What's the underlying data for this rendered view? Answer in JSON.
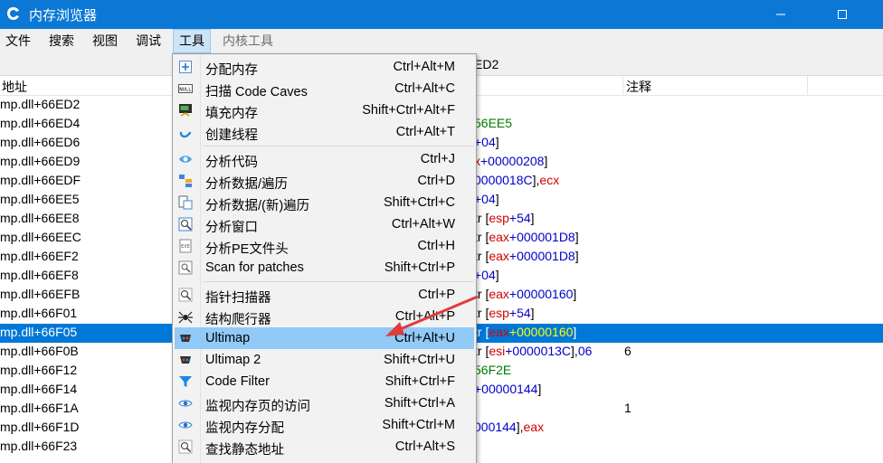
{
  "window": {
    "title": "内存浏览器"
  },
  "menubar": {
    "items": [
      "文件",
      "搜索",
      "视图",
      "调试",
      "工具",
      "内核工具"
    ]
  },
  "address_line": "ED2",
  "columns": {
    "address": "地址",
    "comment": "注释"
  },
  "rows": [
    {
      "addr": "mp.dll+66ED2",
      "op": []
    },
    {
      "addr": "mp.dll+66ED4",
      "op": [
        [
          "green",
          "56EE5"
        ]
      ]
    },
    {
      "addr": "mp.dll+66ED6",
      "op": [
        [
          "blue",
          "+04"
        ],
        [
          "",
          "]"
        ]
      ]
    },
    {
      "addr": "mp.dll+66ED9",
      "op": [
        [
          "red",
          "x"
        ],
        [
          "blue",
          "+00000208"
        ],
        [
          "",
          "]"
        ]
      ]
    },
    {
      "addr": "mp.dll+66EDF",
      "op": [
        [
          "blue",
          "0000018C"
        ],
        [
          "",
          "],"
        ],
        [
          "red",
          "ecx"
        ]
      ]
    },
    {
      "addr": "mp.dll+66EE5",
      "op": [
        [
          "blue",
          "+04"
        ],
        [
          "",
          "]"
        ]
      ]
    },
    {
      "addr": "mp.dll+66EE8",
      "op": [
        [
          "",
          "tr ["
        ],
        [
          "red",
          "esp"
        ],
        [
          "blue",
          "+54"
        ],
        [
          "",
          "]"
        ]
      ]
    },
    {
      "addr": "mp.dll+66EEC",
      "op": [
        [
          "",
          "tr ["
        ],
        [
          "red",
          "eax"
        ],
        [
          "blue",
          "+000001D8"
        ],
        [
          "",
          "]"
        ]
      ]
    },
    {
      "addr": "mp.dll+66EF2",
      "op": [
        [
          "",
          "tr ["
        ],
        [
          "red",
          "eax"
        ],
        [
          "blue",
          "+000001D8"
        ],
        [
          "",
          "]"
        ]
      ]
    },
    {
      "addr": "mp.dll+66EF8",
      "op": [
        [
          "blue",
          "+04"
        ],
        [
          "",
          "]"
        ]
      ]
    },
    {
      "addr": "mp.dll+66EFB",
      "op": [
        [
          "",
          "tr ["
        ],
        [
          "red",
          "eax"
        ],
        [
          "blue",
          "+00000160"
        ],
        [
          "",
          "]"
        ]
      ]
    },
    {
      "addr": "mp.dll+66F01",
      "op": [
        [
          "",
          "tr ["
        ],
        [
          "red",
          "esp"
        ],
        [
          "blue",
          "+54"
        ],
        [
          "",
          "]"
        ]
      ]
    },
    {
      "addr": "mp.dll+66F05",
      "op": [
        [
          "",
          "tr ["
        ],
        [
          "red",
          "eax"
        ],
        [
          "yl",
          "+00000160"
        ],
        [
          "",
          "]"
        ]
      ],
      "selected": true
    },
    {
      "addr": "mp.dll+66F0B",
      "op": [
        [
          "",
          "tr ["
        ],
        [
          "red",
          "esi"
        ],
        [
          "blue",
          "+0000013C"
        ],
        [
          "",
          "],"
        ],
        [
          "blue",
          "06"
        ]
      ],
      "cmt": "6"
    },
    {
      "addr": "mp.dll+66F12",
      "op": [
        [
          "green",
          "56F2E"
        ]
      ]
    },
    {
      "addr": "mp.dll+66F14",
      "op": [
        [
          "blue",
          "+00000144"
        ],
        [
          "",
          "]"
        ]
      ]
    },
    {
      "addr": "mp.dll+66F1A",
      "op": [],
      "cmt": "1"
    },
    {
      "addr": "mp.dll+66F1D",
      "op": [
        [
          "blue",
          "000144"
        ],
        [
          "",
          "],"
        ],
        [
          "red",
          "eax"
        ]
      ]
    },
    {
      "addr": "mp.dll+66F23",
      "op": []
    }
  ],
  "tools_menu": {
    "groups": [
      [
        {
          "icon": "plus-icon",
          "label": "分配内存",
          "shortcut": "Ctrl+Alt+M"
        },
        {
          "icon": "scan-icon",
          "label": "扫描 Code Caves",
          "shortcut": "Ctrl+Alt+C"
        },
        {
          "icon": "fill-icon",
          "label": "填充内存",
          "shortcut": "Shift+Ctrl+Alt+F"
        },
        {
          "icon": "thread-icon",
          "label": "创建线程",
          "shortcut": "Ctrl+Alt+T"
        }
      ],
      [
        {
          "icon": "eye-code-icon",
          "label": "分析代码",
          "shortcut": "Ctrl+J"
        },
        {
          "icon": "struct-icon",
          "label": "分析数据/遍历",
          "shortcut": "Ctrl+D"
        },
        {
          "icon": "struct-new-icon",
          "label": "分析数据/(新)遍历",
          "shortcut": "Shift+Ctrl+C"
        },
        {
          "icon": "window-icon",
          "label": "分析窗口",
          "shortcut": "Ctrl+Alt+W"
        },
        {
          "icon": "exe-icon",
          "label": "分析PE文件头",
          "shortcut": "Ctrl+H"
        },
        {
          "icon": "patch-icon",
          "label": "Scan for patches",
          "shortcut": "Shift+Ctrl+P"
        }
      ],
      [
        {
          "icon": "magnifier-icon",
          "label": "指针扫描器",
          "shortcut": "Ctrl+P"
        },
        {
          "icon": "spider-icon",
          "label": "结构爬行器",
          "shortcut": "Ctrl+Alt+P"
        },
        {
          "icon": "ultimap-icon",
          "label": "Ultimap",
          "shortcut": "Ctrl+Alt+U",
          "highlighted": true
        },
        {
          "icon": "ultimap2-icon",
          "label": "Ultimap 2",
          "shortcut": "Shift+Ctrl+U"
        },
        {
          "icon": "filter-icon",
          "label": "Code Filter",
          "shortcut": "Shift+Ctrl+F"
        },
        {
          "icon": "eye-icon",
          "label": "监视内存页的访问",
          "shortcut": "Shift+Ctrl+A"
        },
        {
          "icon": "eye-icon",
          "label": "监视内存分配",
          "shortcut": "Shift+Ctrl+M"
        },
        {
          "icon": "magnifier-icon",
          "label": "查找静态地址",
          "shortcut": "Ctrl+Alt+S"
        }
      ]
    ]
  },
  "colors": {
    "titlebar": "#0c78d6",
    "selection": "#0078d7",
    "menu_highlight": "#91c9f7",
    "annotation_arrow": "#e03c3c"
  }
}
